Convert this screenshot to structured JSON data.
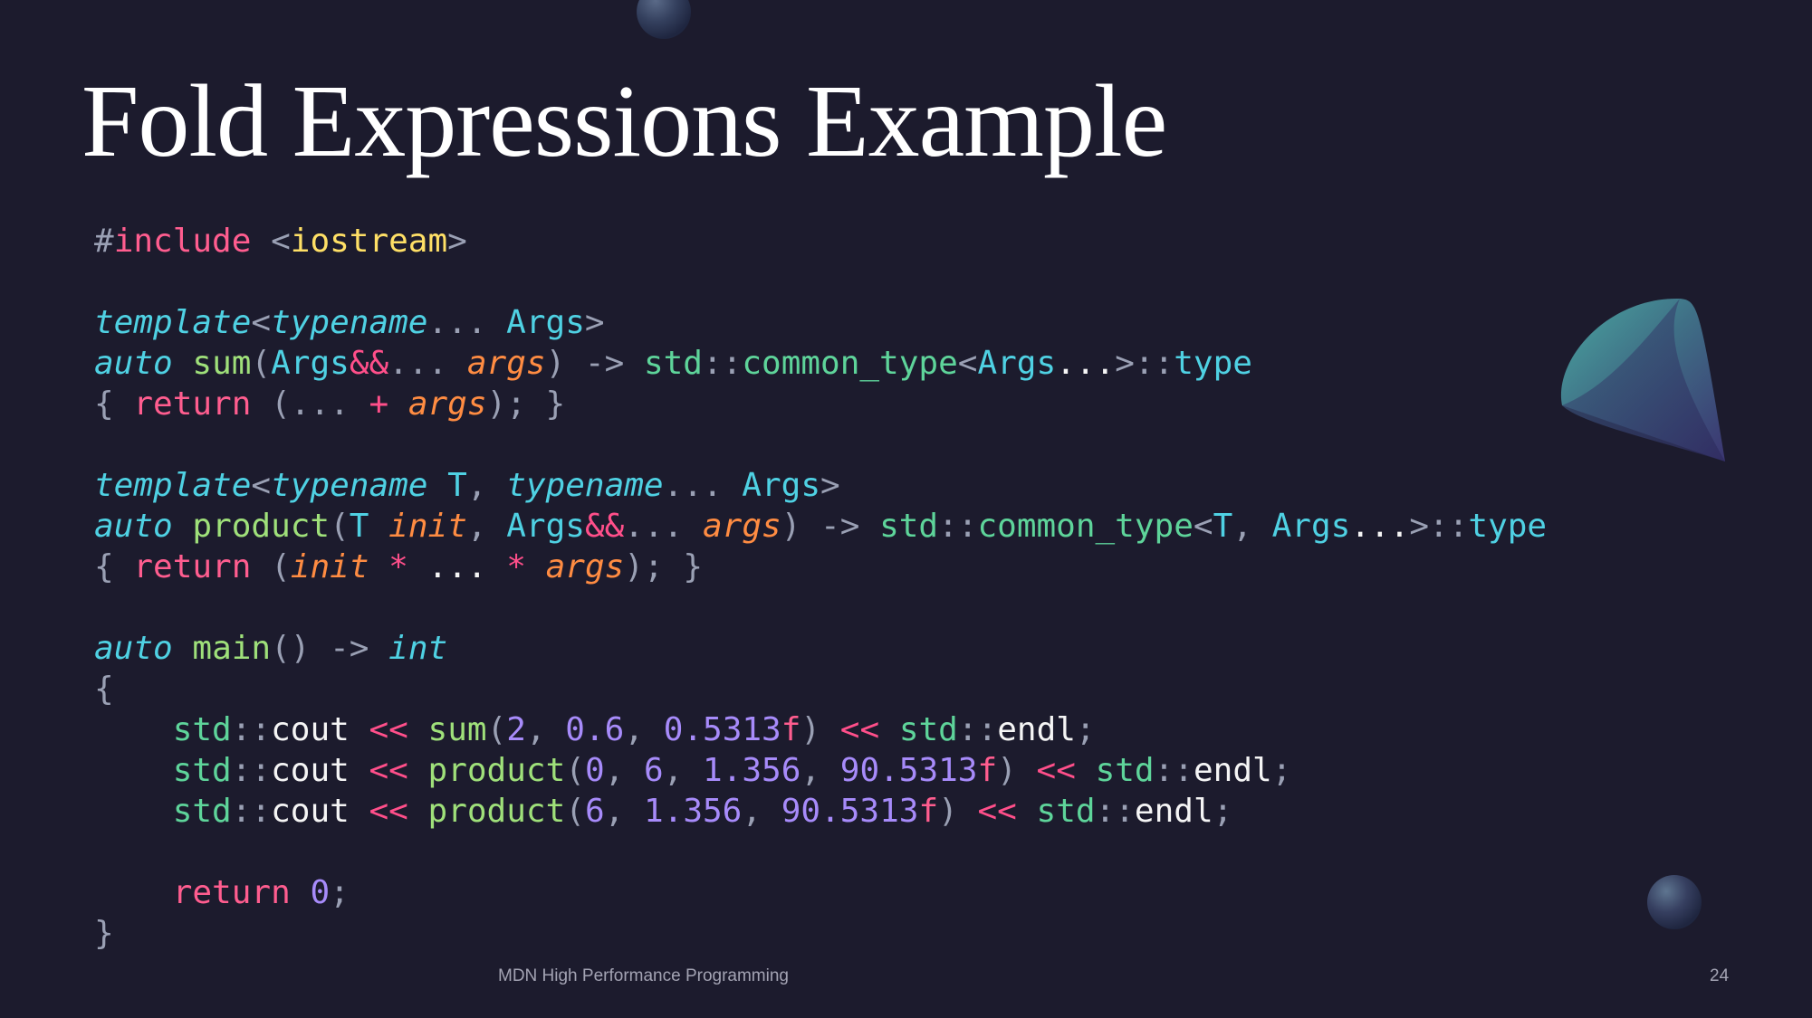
{
  "slide": {
    "title": "Fold Expressions Example",
    "footer": "MDN High Performance Programming",
    "page_number": "24"
  },
  "code": {
    "lines": [
      "#include <iostream>",
      "",
      "template<typename... Args>",
      "auto sum(Args&&... args) -> std::common_type<Args...>::type",
      "{ return (... + args); }",
      "",
      "template<typename T, typename... Args>",
      "auto product(T init, Args&&... args) -> std::common_type<T, Args...>::type",
      "{ return (init * ... * args); }",
      "",
      "auto main() -> int",
      "{",
      "    std::cout << sum(2, 0.6, 0.5313f) << std::endl;",
      "    std::cout << product(0, 6, 1.356, 90.5313f) << std::endl;",
      "    std::cout << product(6, 1.356, 90.5313f) << std::endl;",
      "",
      "    return 0;",
      "}"
    ]
  },
  "colors": {
    "background": "#1c1b2d",
    "keyword": "#ff5d8f",
    "type": "#4fd1e3",
    "function": "#9fe07a",
    "parameter": "#ff8c42",
    "namespace": "#5ed49a",
    "number": "#a78bfa",
    "header": "#ffe066"
  },
  "decorations": [
    "sphere-top",
    "cone-right",
    "sphere-bottom-right"
  ]
}
